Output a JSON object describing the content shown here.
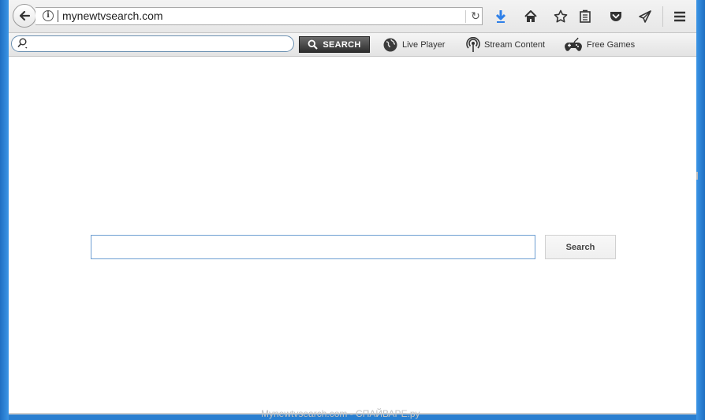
{
  "browser": {
    "url": "mynewtvsearch.com",
    "toolbar_icons": [
      "back-arrow-icon",
      "info-icon",
      "reload-icon",
      "download-icon",
      "home-icon",
      "bookmark-star-icon",
      "reading-list-icon",
      "pocket-icon",
      "send-icon",
      "menu-icon"
    ],
    "download_color": "#2f80e8"
  },
  "search_toolbar": {
    "search_button": "SEARCH",
    "links": [
      {
        "label": "Live Player",
        "icon": "globe-icon"
      },
      {
        "label": "Stream Content",
        "icon": "broadcast-icon"
      },
      {
        "label": "Free Games",
        "icon": "gamepad-icon"
      }
    ]
  },
  "page": {
    "search_value": "",
    "search_button": "Search"
  },
  "watermark": "Mynewtvsearch.com - СПАЙВАРЕ.ру"
}
